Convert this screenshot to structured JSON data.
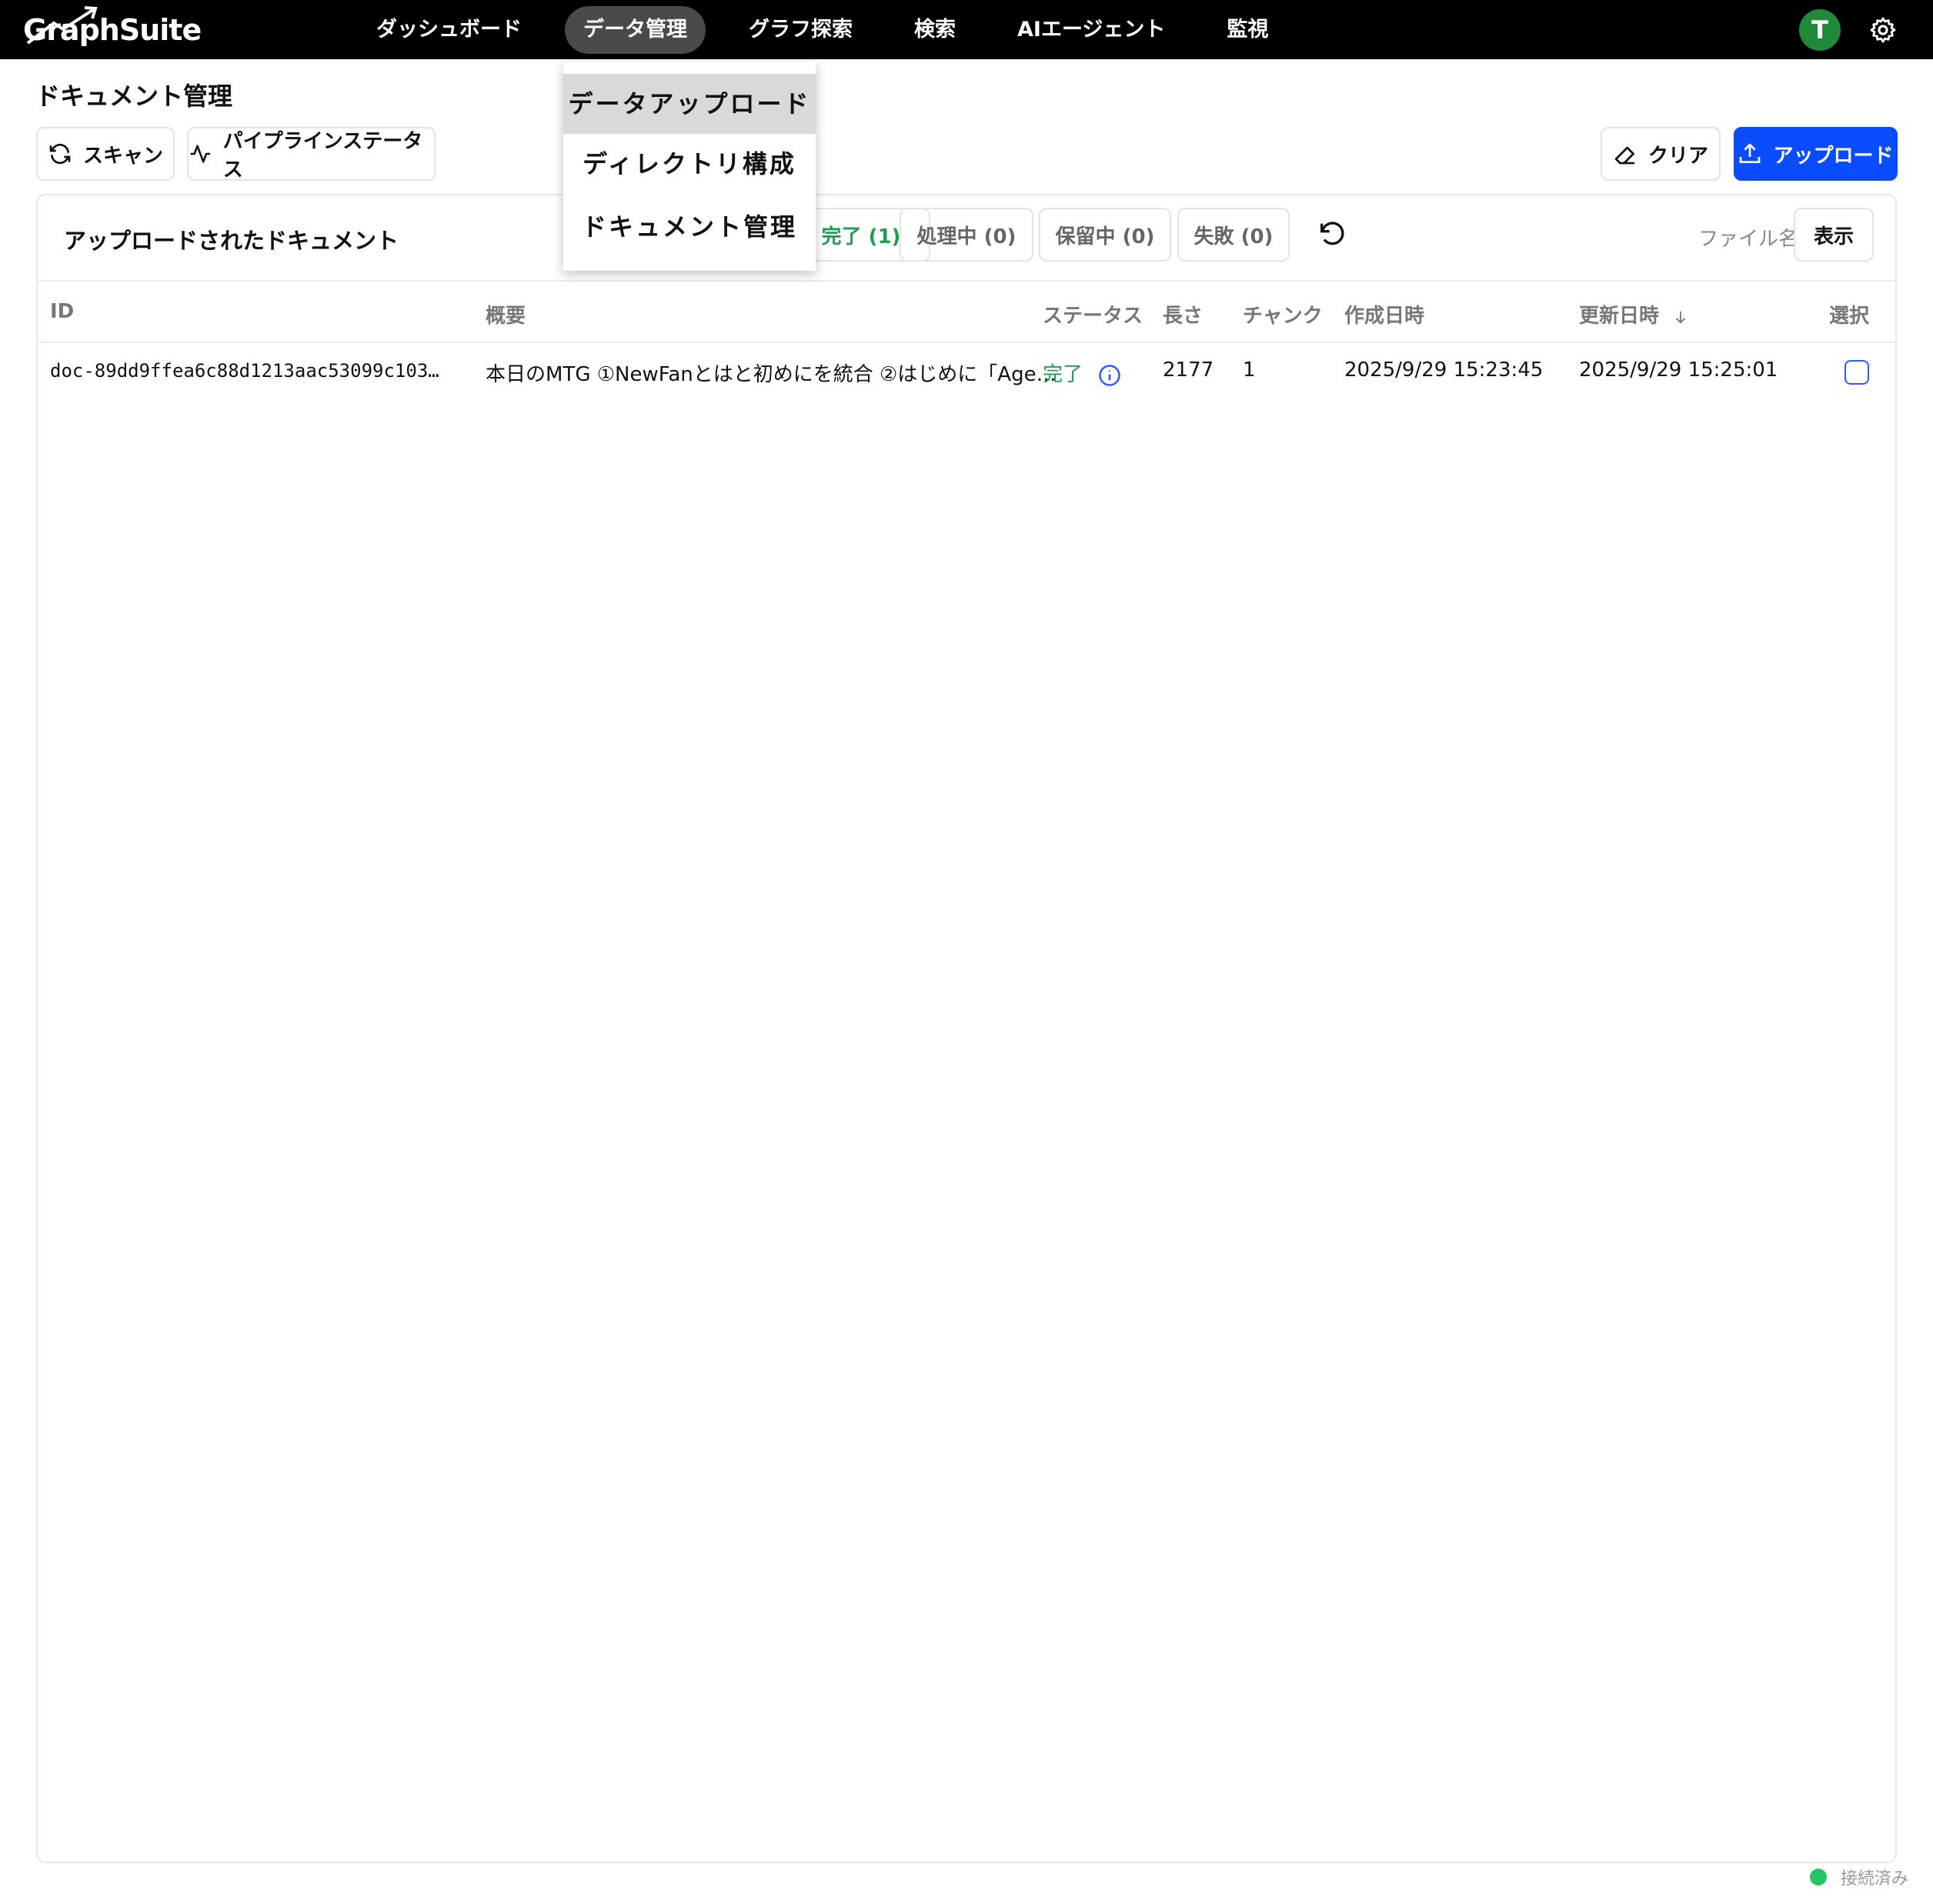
{
  "brand": {
    "name": "GraphSuite"
  },
  "nav": {
    "items": [
      {
        "label": "ダッシュボード"
      },
      {
        "label": "データ管理"
      },
      {
        "label": "グラフ探索"
      },
      {
        "label": "検索"
      },
      {
        "label": "AIエージェント"
      },
      {
        "label": "監視"
      }
    ],
    "active_index": 1
  },
  "user": {
    "avatar_letter": "T",
    "avatar_color": "#1f8a3a"
  },
  "dropdown": {
    "items": [
      {
        "label": "データアップロード"
      },
      {
        "label": "ディレクトリ構成"
      },
      {
        "label": "ドキュメント管理"
      }
    ],
    "highlighted_index": 0
  },
  "page": {
    "title": "ドキュメント管理"
  },
  "toolbar": {
    "scan_label": "スキャン",
    "pipeline_label": "パイプラインステータス",
    "clear_label": "クリア",
    "upload_label": "アップロード"
  },
  "card": {
    "title": "アップロードされたドキュメント",
    "filters": {
      "done": "完了 (1)",
      "processing": "処理中 (0)",
      "pending": "保留中 (0)",
      "failed": "失敗 (0)"
    },
    "file_label": "ファイル名",
    "show_label": "表示"
  },
  "table": {
    "columns": {
      "id": "ID",
      "summary": "概要",
      "status": "ステータス",
      "length": "長さ",
      "chunks": "チャンク",
      "created": "作成日時",
      "updated": "更新日時",
      "select": "選択"
    },
    "rows": [
      {
        "id": "doc-89dd9ffea6c88d1213aac53099c103…",
        "summary": "本日のMTG ①NewFanとはと初めにを統合 ②はじめに「Age…",
        "status": "完了",
        "length": "2177",
        "chunks": "1",
        "created": "2025/9/29 15:23:45",
        "updated": "2025/9/29 15:25:01",
        "selected": false
      }
    ]
  },
  "connection": {
    "label": "接続済み",
    "color": "#22c55e"
  },
  "colors": {
    "primary": "#0a4cff",
    "success": "#1f9d55",
    "topbar": "#000000"
  }
}
